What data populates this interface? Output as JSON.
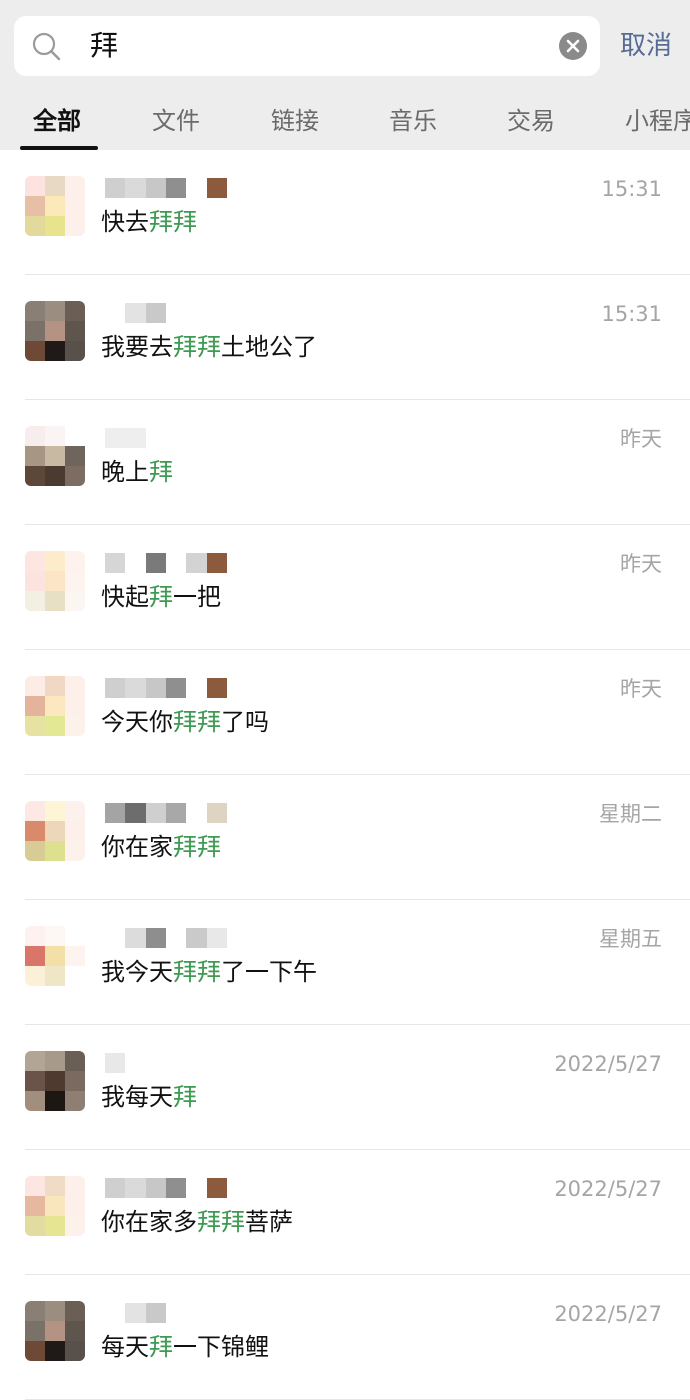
{
  "search": {
    "query": "拜",
    "cancel_label": "取消"
  },
  "tabs": [
    {
      "label": "全部",
      "active": true
    },
    {
      "label": "文件",
      "active": false
    },
    {
      "label": "链接",
      "active": false
    },
    {
      "label": "音乐",
      "active": false
    },
    {
      "label": "交易",
      "active": false
    },
    {
      "label": "小程序",
      "active": false
    }
  ],
  "colors": {
    "highlight": "#3e9a52",
    "link": "#576b95",
    "time": "#a5a5a5",
    "header_bg": "#ededed"
  },
  "results": [
    {
      "time": "15:31",
      "message": [
        {
          "t": "快去"
        },
        {
          "t": "拜拜",
          "hl": true
        }
      ],
      "avatar": [
        "#fde3e0",
        "#e8d9c4",
        "#fdf0ea",
        "#e6bfa5",
        "#fbe9b9",
        "#fdf0ea",
        "#e3d99c",
        "#e8e48e",
        "#fdf0ea"
      ],
      "name_blur": [
        "#cfcfcf",
        "#dadada",
        "#c7c7c7",
        "#8f8f8f",
        "#ffffff",
        "#8c5a3c"
      ]
    },
    {
      "time": "15:31",
      "message": [
        {
          "t": "我要去"
        },
        {
          "t": "拜拜",
          "hl": true
        },
        {
          "t": "土地公了"
        }
      ],
      "avatar": [
        "#8a7f75",
        "#9b8d7f",
        "#6b5f55",
        "#7a7268",
        "#b49284",
        "#5e554d",
        "#6e4a36",
        "#1f1a17",
        "#58504a"
      ],
      "name_blur": [
        "#ffffff",
        "#e3e3e3",
        "#c9c9c9",
        "#ffffff",
        "#ffffff",
        "#ffffff"
      ]
    },
    {
      "time": "昨天",
      "message": [
        {
          "t": "晚上"
        },
        {
          "t": "拜",
          "hl": true
        }
      ],
      "avatar": [
        "#f7eded",
        "#fbf4f4",
        "#ffffff",
        "#a89685",
        "#c8b9a3",
        "#6e655d",
        "#5c4738",
        "#4a3a30",
        "#7c6c62"
      ],
      "name_blur": [
        "#eeeeee",
        "#eeeeee",
        "#ffffff",
        "#ffffff",
        "#ffffff",
        "#ffffff"
      ]
    },
    {
      "time": "昨天",
      "message": [
        {
          "t": "快起"
        },
        {
          "t": "拜",
          "hl": true
        },
        {
          "t": "一把"
        }
      ],
      "avatar": [
        "#fde6e2",
        "#fdecc9",
        "#fdf2ee",
        "#fde3e0",
        "#fce5c7",
        "#fdf3ef",
        "#f3efe3",
        "#e7e0c4",
        "#fcf6f2"
      ],
      "name_blur": [
        "#d6d6d6",
        "#ffffff",
        "#7a7a7a",
        "#ffffff",
        "#d3d3d3",
        "#8c5a3c"
      ]
    },
    {
      "time": "昨天",
      "message": [
        {
          "t": "今天你"
        },
        {
          "t": "拜拜",
          "hl": true
        },
        {
          "t": "了吗"
        }
      ],
      "avatar": [
        "#fdece6",
        "#f0d8c4",
        "#fdf0ea",
        "#e3b49b",
        "#fbe7c0",
        "#fdf0ea",
        "#e6e3a2",
        "#e3e895",
        "#fdf1ec"
      ],
      "name_blur": [
        "#cfcfcf",
        "#dadada",
        "#c7c7c7",
        "#8f8f8f",
        "#ffffff",
        "#8c5a3c"
      ]
    },
    {
      "time": "星期二",
      "message": [
        {
          "t": "你在家"
        },
        {
          "t": "拜拜",
          "hl": true
        }
      ],
      "avatar": [
        "#fde8e4",
        "#fdf5d6",
        "#fdf1ed",
        "#d98a6a",
        "#ecd7bb",
        "#fdf0ea",
        "#d7cc95",
        "#dde08e",
        "#fdf1ec"
      ],
      "name_blur": [
        "#a4a4a4",
        "#6d6d6d",
        "#cfcfcf",
        "#a8a8a8",
        "#ffffff",
        "#ddd4c4"
      ]
    },
    {
      "time": "星期五",
      "message": [
        {
          "t": "我今天"
        },
        {
          "t": "拜拜",
          "hl": true
        },
        {
          "t": "了一下午"
        }
      ],
      "avatar": [
        "#fdf2f0",
        "#fdf8f4",
        "#ffffff",
        "#d9766a",
        "#f2e0a6",
        "#fdf3ef",
        "#fdf0d8",
        "#efe6c6",
        "#ffffff"
      ],
      "name_blur": [
        "#ffffff",
        "#dcdcdc",
        "#8e8e8e",
        "#ffffff",
        "#cacaca",
        "#e8e8e8"
      ]
    },
    {
      "time": "2022/5/27",
      "message": [
        {
          "t": "我每天"
        },
        {
          "t": "拜",
          "hl": true
        }
      ],
      "avatar": [
        "#b2a595",
        "#a89a8b",
        "#6a5f56",
        "#6a5449",
        "#4f3a30",
        "#7a6a60",
        "#a18e7c",
        "#1d1714",
        "#8f7f72"
      ],
      "name_blur": [
        "#e8e8e8",
        "#ffffff",
        "#ffffff",
        "#ffffff",
        "#ffffff",
        "#ffffff"
      ]
    },
    {
      "time": "2022/5/27",
      "message": [
        {
          "t": "你在家多"
        },
        {
          "t": "拜拜",
          "hl": true
        },
        {
          "t": "菩萨"
        }
      ],
      "avatar": [
        "#fde6e1",
        "#f0dcc6",
        "#fdf0ea",
        "#e6b8a0",
        "#fae6bd",
        "#fdf0ea",
        "#e3dca0",
        "#e6e592",
        "#fdf1ec"
      ],
      "name_blur": [
        "#cfcfcf",
        "#dadada",
        "#c7c7c7",
        "#8f8f8f",
        "#ffffff",
        "#8c5a3c"
      ]
    },
    {
      "time": "2022/5/27",
      "message": [
        {
          "t": "每天"
        },
        {
          "t": "拜",
          "hl": true
        },
        {
          "t": "一下锦鲤"
        }
      ],
      "avatar": [
        "#8a7f75",
        "#9b8d7f",
        "#6b5f55",
        "#7a7268",
        "#b49284",
        "#5e554d",
        "#6e4a36",
        "#1f1a17",
        "#58504a"
      ],
      "name_blur": [
        "#ffffff",
        "#e3e3e3",
        "#c9c9c9",
        "#ffffff",
        "#ffffff",
        "#ffffff"
      ]
    }
  ]
}
